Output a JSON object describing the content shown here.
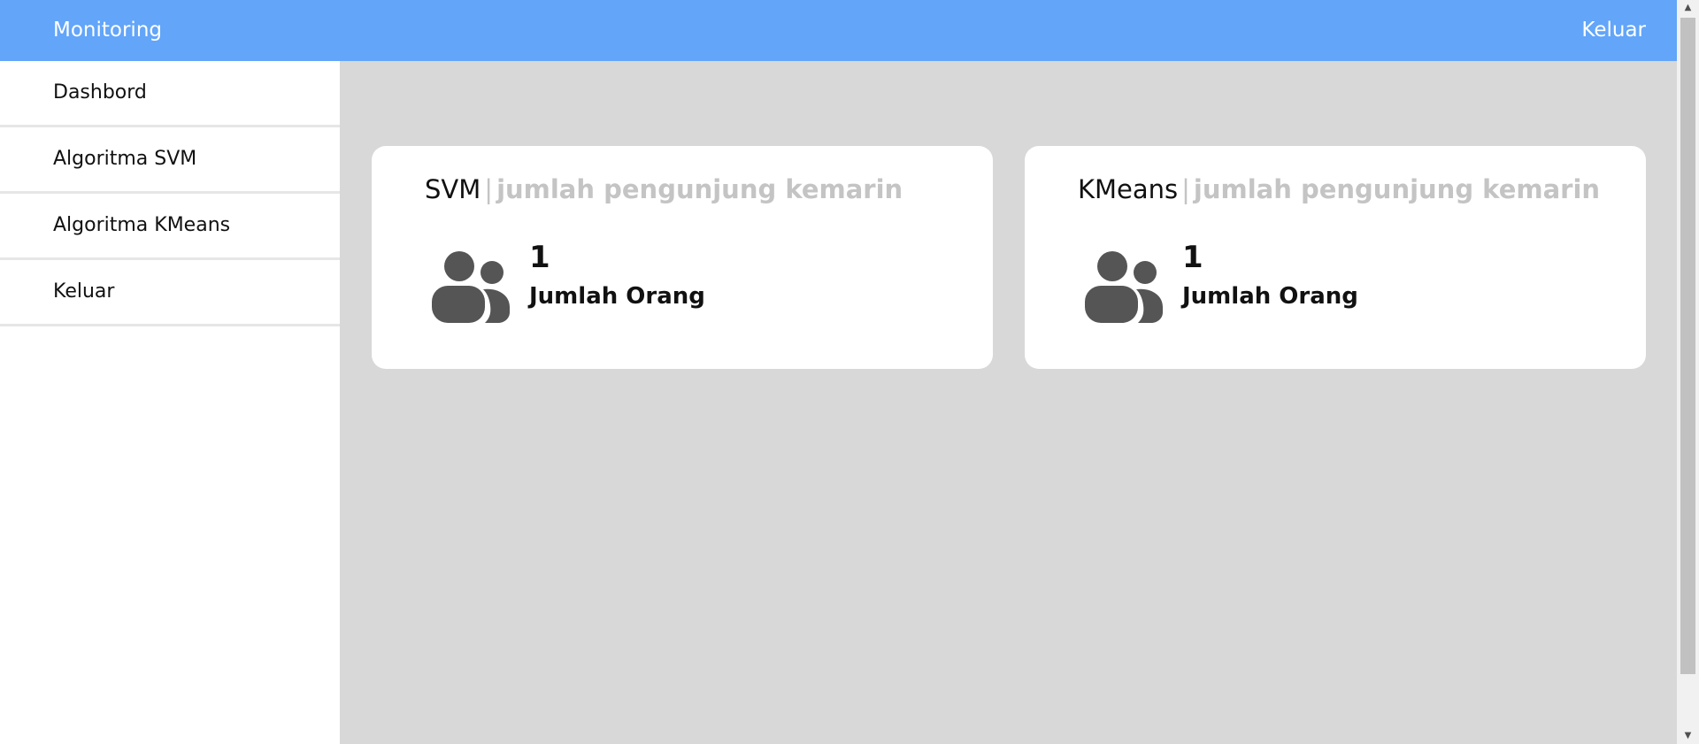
{
  "header": {
    "brand": "Monitoring",
    "logout_label": "Keluar"
  },
  "sidebar": {
    "items": [
      {
        "label": "Dashbord"
      },
      {
        "label": "Algoritma SVM"
      },
      {
        "label": "Algoritma KMeans"
      },
      {
        "label": "Keluar"
      }
    ]
  },
  "cards": [
    {
      "title": "SVM",
      "separator": "|",
      "subtitle": "jumlah pengunjung kemarin",
      "icon": "users-icon",
      "count": "1",
      "label": "Jumlah Orang"
    },
    {
      "title": "KMeans",
      "separator": "|",
      "subtitle": "jumlah pengunjung kemarin",
      "icon": "users-icon",
      "count": "1",
      "label": "Jumlah Orang"
    }
  ],
  "scrollbar": {
    "up_glyph": "▲",
    "down_glyph": "▼"
  },
  "colors": {
    "header_bg": "#62a5f9",
    "main_bg": "#d8d8d8",
    "subtitle_text": "#c4c4c4",
    "icon_fill": "#555555"
  }
}
